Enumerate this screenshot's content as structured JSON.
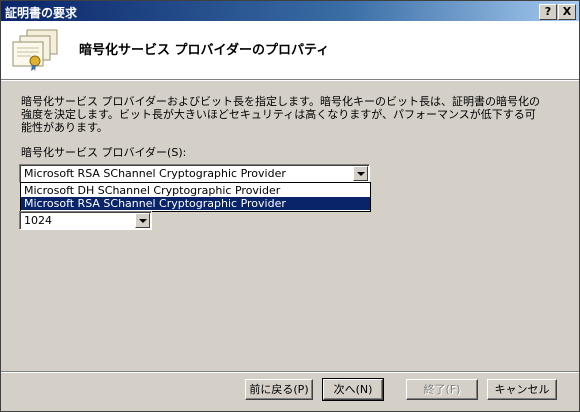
{
  "window": {
    "title": "証明書の要求",
    "help_btn": "?",
    "close_btn": "X"
  },
  "header": {
    "title": "暗号化サービス プロバイダーのプロパティ",
    "icon": "certificate-icon"
  },
  "body": {
    "description": "暗号化サービス プロバイダーおよびビット長を指定します。暗号化キーのビット長は、証明書の暗号化の強度を決定します。ビット長が大きいほどセキュリティは高くなりますが、パフォーマンスが低下する可能性があります。",
    "csp_label": "暗号化サービス プロバイダー(S):",
    "csp_selected": "Microsoft RSA SChannel Cryptographic Provider",
    "csp_options": [
      "Microsoft DH SChannel Cryptographic Provider",
      "Microsoft RSA SChannel Cryptographic Provider"
    ],
    "bit_length_selected": "1024"
  },
  "buttons": {
    "back": "前に戻る(P)",
    "next": "次へ(N)",
    "finish": "終了(F)",
    "cancel": "キャンセル"
  },
  "colors": {
    "title_bar": "#0a246a",
    "selection": "#0a246a",
    "dialog_face": "#d4d0c8"
  }
}
